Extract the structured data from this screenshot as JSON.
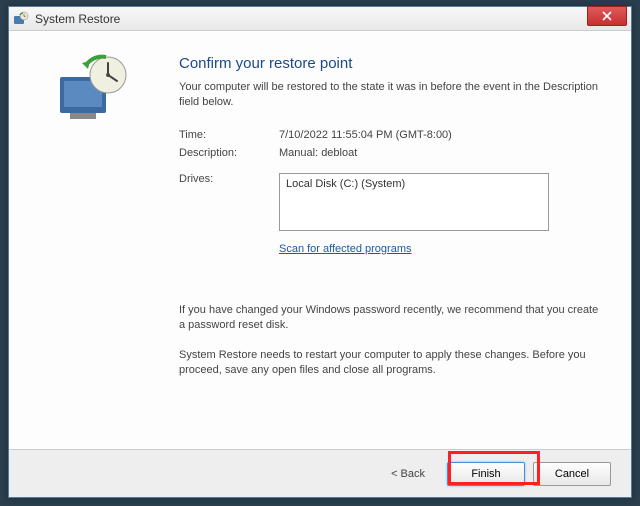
{
  "window": {
    "title": "System Restore"
  },
  "header": {
    "heading": "Confirm your restore point",
    "subheading": "Your computer will be restored to the state it was in before the event in the Description field below."
  },
  "info": {
    "time_label": "Time:",
    "time_value": "7/10/2022 11:55:04 PM (GMT-8:00)",
    "description_label": "Description:",
    "description_value": "Manual: debloat",
    "drives_label": "Drives:",
    "drives_value": "Local Disk (C:) (System)"
  },
  "links": {
    "scan": "Scan for affected programs"
  },
  "notes": {
    "password": "If you have changed your Windows password recently, we recommend that you create a password reset disk.",
    "restart": "System Restore needs to restart your computer to apply these changes. Before you proceed, save any open files and close all programs."
  },
  "buttons": {
    "back": "< Back",
    "finish": "Finish",
    "cancel": "Cancel"
  }
}
